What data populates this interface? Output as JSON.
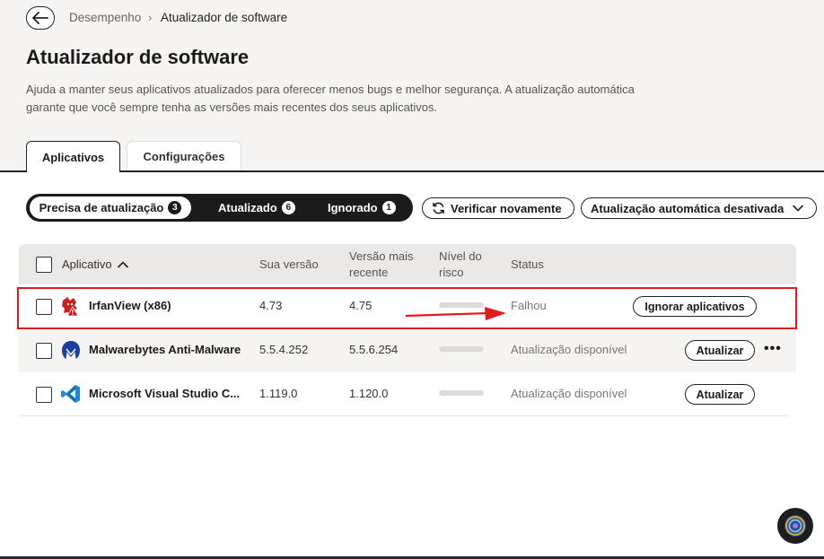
{
  "breadcrumb": {
    "parent": "Desempenho",
    "separator": "›",
    "current": "Atualizador de software"
  },
  "page": {
    "title": "Atualizador de software",
    "description": "Ajuda a manter seus aplicativos atualizados para oferecer menos bugs e melhor segurança. A atualização automática garante que você sempre tenha as versões mais recentes dos seus aplicativos."
  },
  "tabs": [
    {
      "label": "Aplicativos",
      "active": true
    },
    {
      "label": "Configurações",
      "active": false
    }
  ],
  "filters": [
    {
      "label": "Precisa de atualização",
      "count": "3",
      "active": true
    },
    {
      "label": "Atualizado",
      "count": "6",
      "active": false
    },
    {
      "label": "Ignorado",
      "count": "1",
      "active": false
    }
  ],
  "actions": {
    "verify_label": "Verificar novamente",
    "auto_update_label": "Atualização automática desativada"
  },
  "table": {
    "headers": {
      "app": "Aplicativo",
      "your_version": "Sua versão",
      "latest_line1": "Versão mais",
      "latest_line2": "recente",
      "risk_line1": "Nível do",
      "risk_line2": "risco",
      "status": "Status"
    },
    "rows": [
      {
        "name": "IrfanView (x86)",
        "icon": "irfanview-icon",
        "your_version": "4.73",
        "latest": "4.75",
        "status": "Falhou",
        "action": "Ignorar aplicativos"
      },
      {
        "name": "Malwarebytes Anti-Malware",
        "icon": "malwarebytes-icon",
        "your_version": "5.5.4.252",
        "latest": "5.5.6.254",
        "status": "Atualização disponível",
        "action": "Atualizar"
      },
      {
        "name": "Microsoft Visual Studio C...",
        "icon": "vscode-icon",
        "your_version": "1.119.0",
        "latest": "1.120.0",
        "status": "Atualização disponível",
        "action": "Atualizar"
      }
    ]
  },
  "colors": {
    "highlight": "#e2191d",
    "dark": "#1b1b1b",
    "header_bg": "#f6f4f2"
  }
}
